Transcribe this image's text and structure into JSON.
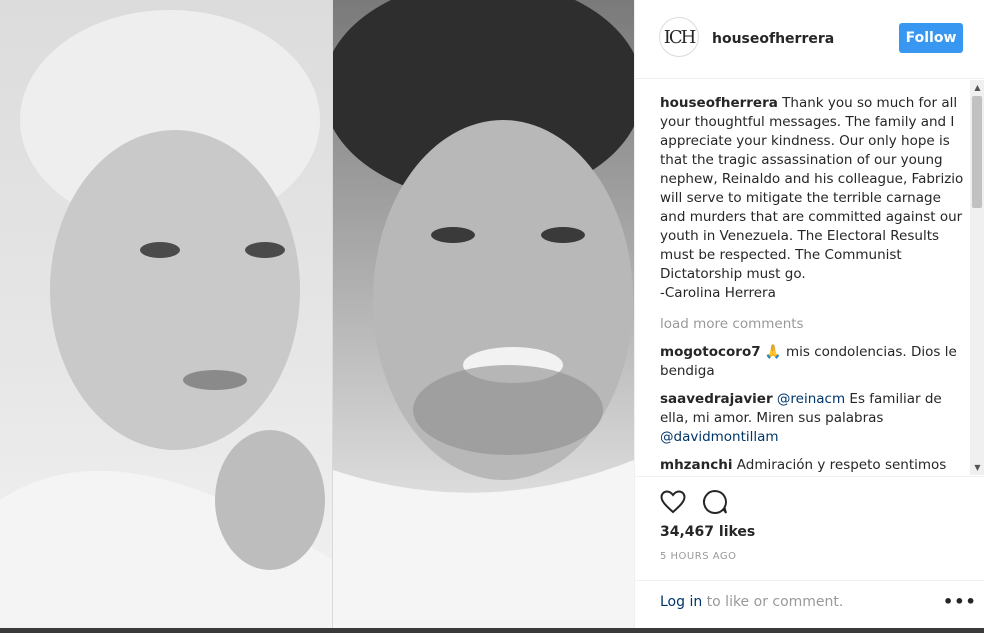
{
  "post": {
    "username": "houseofherrera",
    "follow_label": "Follow",
    "avatar_text": "ICH"
  },
  "caption": {
    "username": "houseofherrera",
    "text": "Thank you so much for all your thoughtful messages. The family and I appreciate your kindness. Our only hope is that the tragic assassination of our young nephew, Reinaldo and his colleague, Fabrizio will serve to mitigate the terrible carnage and murders that are committed against our youth in Venezuela. The Electoral Results must be respected. The Communist Dictatorship must go.",
    "signature": "-Carolina Herrera"
  },
  "load_more_label": "load more comments",
  "comments": [
    {
      "username": "mogotocoro7",
      "text": "🙏 mis condolencias. Dios le bendiga"
    },
    {
      "username": "saavedrajavier",
      "mention1": "@reinacm",
      "text": " Es familiar de ella, mi amor. Miren sus palabras ",
      "mention2": "@davidmontillam"
    },
    {
      "username": "mhzanchi",
      "text": "Admiración y respeto sentimos todos los venezolanos por ti, de que nos"
    }
  ],
  "likes": "34,467 likes",
  "time": "5 HOURS AGO",
  "login": {
    "link": "Log in",
    "rest": " to like or comment."
  },
  "more_label": "•••",
  "icons": [
    "heart-icon",
    "comment-icon",
    "more-options-icon",
    "scroll-up-icon",
    "scroll-down-icon"
  ],
  "colors": {
    "accent": "#3897f0",
    "mention": "#003569",
    "muted": "#999999"
  }
}
